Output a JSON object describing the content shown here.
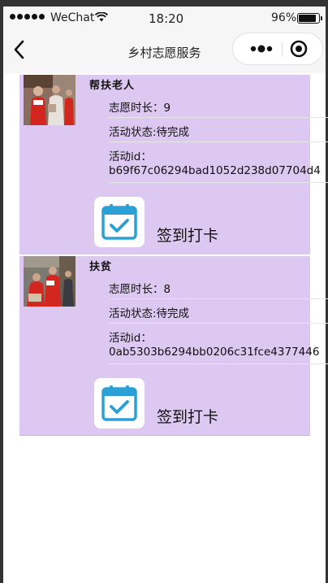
{
  "status_bar": {
    "carrier": "WeChat",
    "time": "18:20",
    "battery": "96%",
    "battery_level": 0.96
  },
  "nav": {
    "title": "乡村志愿服务",
    "back_icon": "back-arrow-icon",
    "more_icon": "more-dots-icon",
    "close_icon": "target-circle-icon"
  },
  "activities": [
    {
      "title": "帮扶老人",
      "duration": "志愿时长：9",
      "status": "活动状态:待完成",
      "id_label": "活动id：",
      "id_value": "b69f67c06294bad1052d238d07704d4",
      "checkin_label": "签到打卡",
      "checkin_icon": "calendar-check-icon"
    },
    {
      "title": "扶贫",
      "duration": "志愿时长：8",
      "status": "活动状态:待完成",
      "id_label": "活动id：",
      "id_value": "0ab5303b6294bb0206c31fce4377446",
      "checkin_label": "签到打卡",
      "checkin_icon": "calendar-check-icon"
    }
  ],
  "colors": {
    "card_bg": "#dcc8f0",
    "icon_blue": "#2aa0d6",
    "nav_bg": "#f6f6f6"
  }
}
